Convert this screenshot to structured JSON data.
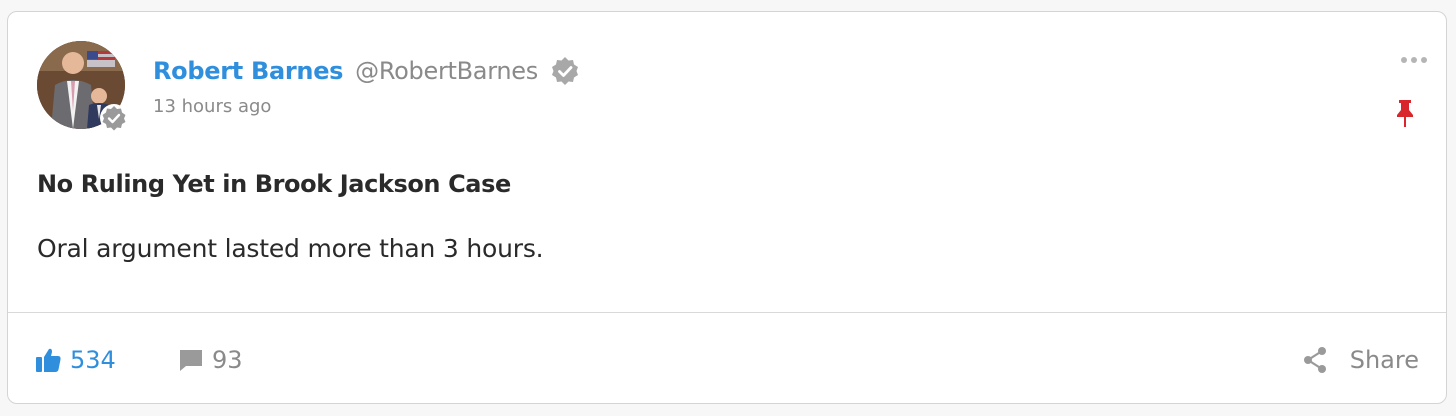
{
  "post": {
    "author_name": "Robert Barnes",
    "author_handle": "@RobertBarnes",
    "timestamp": "13 hours ago",
    "title": "No Ruling Yet in Brook Jackson Case",
    "body": "Oral argument lasted more than 3 hours."
  },
  "icons": {
    "verified": "verified-badge-icon",
    "more": "more-options-icon",
    "pin": "pin-icon",
    "like": "thumbs-up-icon",
    "comment": "comment-icon",
    "share": "share-icon"
  },
  "actions": {
    "like_count": "534",
    "comment_count": "93",
    "share_label": "Share"
  },
  "colors": {
    "accent": "#2f8fdd",
    "muted": "#8a8a8a",
    "pin": "#d9262c",
    "text": "#2a2a2a"
  }
}
